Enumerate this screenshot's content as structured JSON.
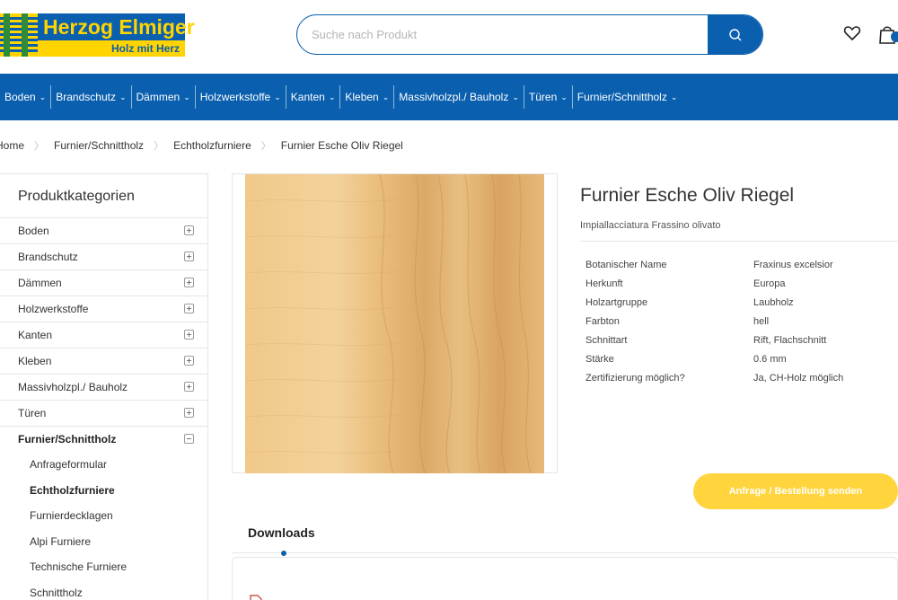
{
  "header": {
    "logo_name": "Herzog Elmiger",
    "logo_tagline": "Holz mit Herz",
    "search_placeholder": "Suche nach Produkt",
    "icons": [
      "search-icon",
      "heart-icon",
      "bag-icon"
    ],
    "brand_color": "#0a5fae",
    "accent_color": "#ffd400"
  },
  "nav": {
    "items": [
      {
        "label": "Boden"
      },
      {
        "label": "Brandschutz"
      },
      {
        "label": "Dämmen"
      },
      {
        "label": "Holzwerkstoffe"
      },
      {
        "label": "Kanten"
      },
      {
        "label": "Kleben"
      },
      {
        "label": "Massivholzpl./ Bauholz"
      },
      {
        "label": "Türen"
      },
      {
        "label": "Furnier/Schnittholz"
      }
    ]
  },
  "breadcrumb": [
    "Home",
    "Furnier/Schnittholz",
    "Echtholzfurniere",
    "Furnier Esche Oliv Riegel"
  ],
  "sidebar": {
    "title": "Produktkategorien",
    "categories": [
      {
        "label": "Boden"
      },
      {
        "label": "Brandschutz"
      },
      {
        "label": "Dämmen"
      },
      {
        "label": "Holzwerkstoffe"
      },
      {
        "label": "Kanten"
      },
      {
        "label": "Kleben"
      },
      {
        "label": "Massivholzpl./ Bauholz"
      },
      {
        "label": "Türen"
      },
      {
        "label": "Furnier/Schnittholz"
      }
    ],
    "subcategories": [
      {
        "label": "Anfrageformular"
      },
      {
        "label": "Echtholzfurniere"
      },
      {
        "label": "Furnierdecklagen"
      },
      {
        "label": "Alpi Furniere"
      },
      {
        "label": "Technische Furniere"
      },
      {
        "label": "Schnittholz"
      }
    ]
  },
  "product": {
    "title": "Furnier Esche Oliv Riegel",
    "subtitle": "Impiallacciatura Frassino olivato",
    "properties": [
      {
        "key": "Botanischer Name",
        "value": "Fraxinus excelsior"
      },
      {
        "key": "Herkunft",
        "value": "Europa"
      },
      {
        "key": "Holzartgruppe",
        "value": "Laubholz"
      },
      {
        "key": "Farbton",
        "value": "hell"
      },
      {
        "key": "Schnittart",
        "value": "Rift, Flachschnitt"
      },
      {
        "key": "Stärke",
        "value": "0.6 mm"
      },
      {
        "key": "Zertifizierung möglich?",
        "value": "Ja, CH-Holz möglich"
      }
    ],
    "cta_label": "Anfrage / Bestellung senden",
    "cta_color": "#ffd43d"
  },
  "downloads": {
    "tab_label": "Downloads"
  }
}
